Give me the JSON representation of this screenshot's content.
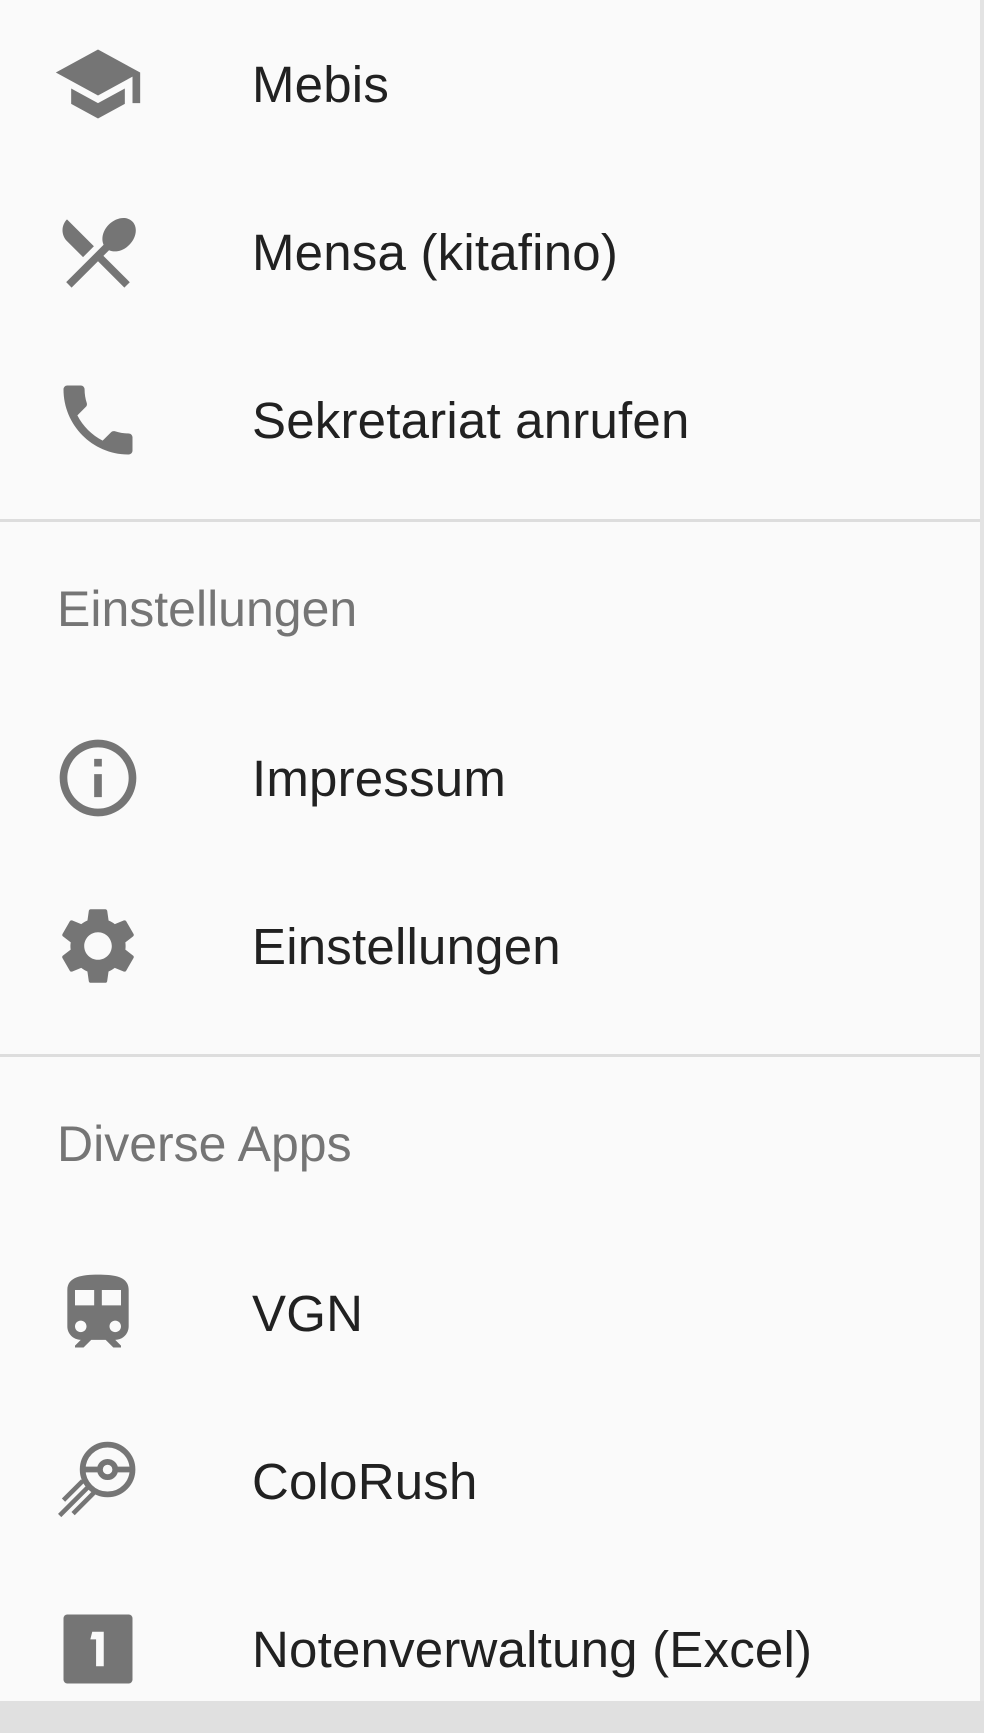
{
  "items_top": [
    {
      "label": "Mebis",
      "icon": "graduation-cap-icon"
    },
    {
      "label": "Mensa (kitafino)",
      "icon": "restaurant-icon"
    },
    {
      "label": "Sekretariat anrufen",
      "icon": "phone-icon"
    }
  ],
  "section_settings": {
    "header": "Einstellungen",
    "items": [
      {
        "label": "Impressum",
        "icon": "info-icon"
      },
      {
        "label": "Einstellungen",
        "icon": "gear-icon"
      }
    ]
  },
  "section_apps": {
    "header": "Diverse Apps",
    "items": [
      {
        "label": "VGN",
        "icon": "train-icon"
      },
      {
        "label": "ColoRush",
        "icon": "colorush-icon"
      },
      {
        "label": "Notenverwaltung (Excel)",
        "icon": "excel-one-icon"
      }
    ]
  },
  "colors": {
    "background": "#fafafa",
    "icon": "#757575",
    "text": "#212121",
    "header_text": "#757575",
    "divider": "#dddddd"
  }
}
